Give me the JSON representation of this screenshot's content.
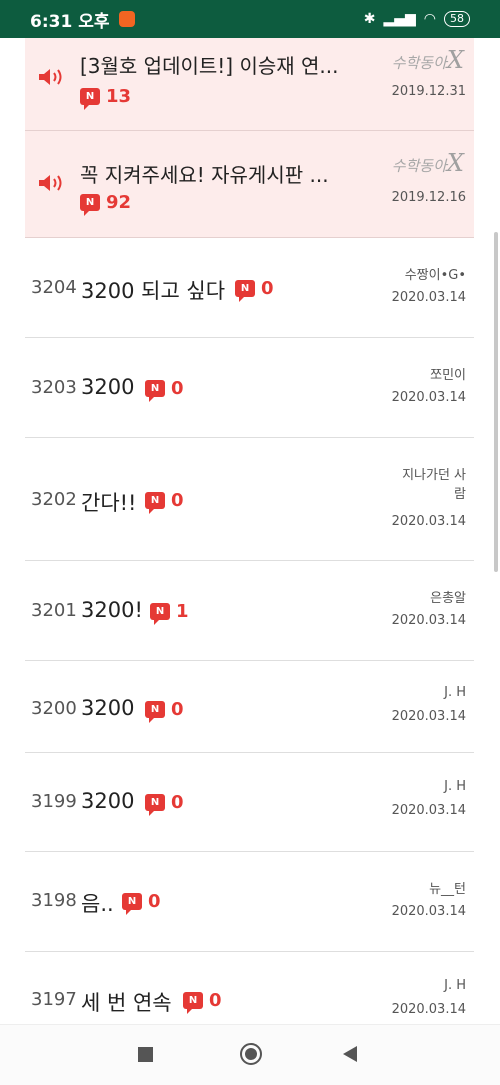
{
  "status_bar": {
    "time": "6:31 오후",
    "battery": "58"
  },
  "notices": [
    {
      "title": "[3월호 업데이트!] 이승재 연...",
      "count": "13",
      "logo": "수학동아",
      "logo_x": "X",
      "date": "2019.12.31"
    },
    {
      "title": "꼭 지켜주세요! 자유게시판 ...",
      "count": "92",
      "logo": "수학동아",
      "logo_x": "X",
      "date": "2019.12.16"
    }
  ],
  "posts": [
    {
      "num": "3204",
      "title": "3200 되고 싶다",
      "count": "0",
      "author": "수짱이•G•",
      "author2": "",
      "date": "2020.03.14"
    },
    {
      "num": "3203",
      "title": "3200",
      "count": "0",
      "author": "쪼민이",
      "author2": "",
      "date": "2020.03.14"
    },
    {
      "num": "3202",
      "title": "간다!!",
      "count": "0",
      "author": "지나가던 사",
      "author2": "람",
      "date": "2020.03.14"
    },
    {
      "num": "3201",
      "title": "3200!",
      "count": "1",
      "author": "은총알",
      "author2": "",
      "date": "2020.03.14"
    },
    {
      "num": "3200",
      "title": "3200",
      "count": "0",
      "author": "J. H",
      "author2": "",
      "date": "2020.03.14"
    },
    {
      "num": "3199",
      "title": "3200",
      "count": "0",
      "author": "J. H",
      "author2": "",
      "date": "2020.03.14"
    },
    {
      "num": "3198",
      "title": "음..",
      "count": "0",
      "author": "뉴__턴",
      "author2": "",
      "date": "2020.03.14"
    },
    {
      "num": "3197",
      "title": "세 번 연속",
      "count": "0",
      "author": "J. H",
      "author2": "",
      "date": "2020.03.14"
    }
  ],
  "badge_icon_label": "N",
  "colors": {
    "status_bar": "#0d5c3f",
    "notice_bg": "#fdeceb",
    "badge_red": "#e53935"
  },
  "icons": {
    "notice": "speaker-icon",
    "comment": "new-comment-icon",
    "nav": [
      "recent-apps-icon",
      "home-icon",
      "back-icon"
    ]
  }
}
